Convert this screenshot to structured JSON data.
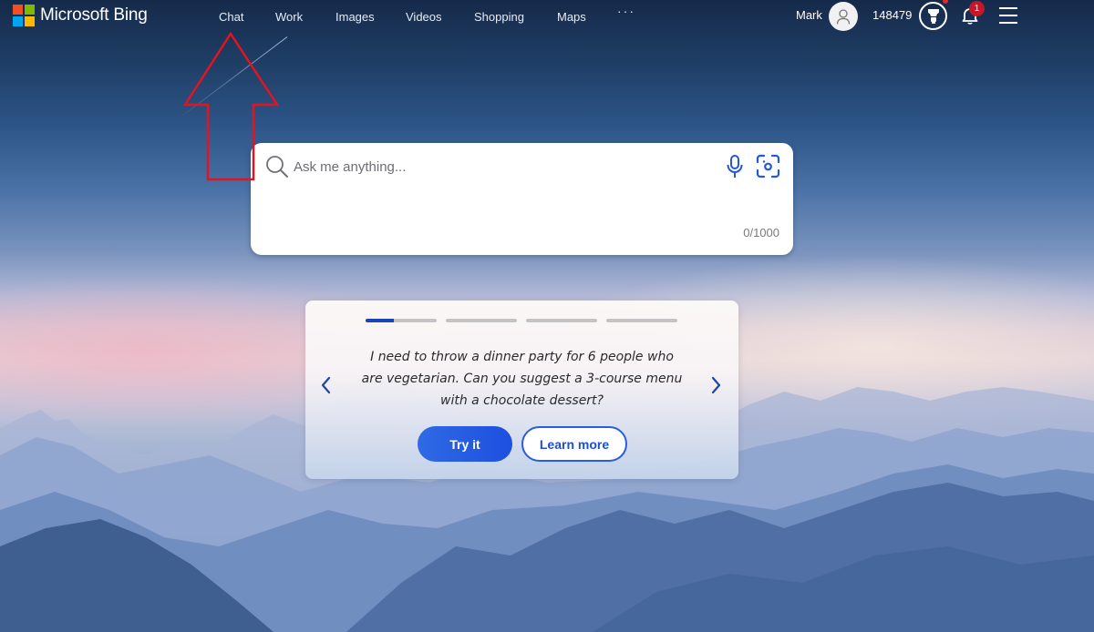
{
  "header": {
    "brand": "Microsoft Bing",
    "logo_colors": [
      "#f25022",
      "#7fba00",
      "#00a4ef",
      "#ffb900"
    ],
    "nav": [
      {
        "label": "Chat"
      },
      {
        "label": "Work"
      },
      {
        "label": "Images"
      },
      {
        "label": "Videos"
      },
      {
        "label": "Shopping"
      },
      {
        "label": "Maps"
      }
    ],
    "more_label": "···",
    "user_name": "Mark",
    "reward_points": "148479",
    "notification_count": "1"
  },
  "search": {
    "placeholder": "Ask me anything...",
    "value": "",
    "char_count": "0/1000"
  },
  "card": {
    "progress": [
      0.4,
      0,
      0,
      0
    ],
    "prompt_text": "I need to throw a dinner party for 6 people who are vegetarian. Can you suggest a 3-course menu with a chocolate dessert?",
    "try_label": "Try it",
    "learn_label": "Learn more"
  },
  "colors": {
    "accent": "#1e4fe0",
    "progress_active": "#1a44b8",
    "annotation": "#e3141f",
    "badge": "#c5162a"
  }
}
